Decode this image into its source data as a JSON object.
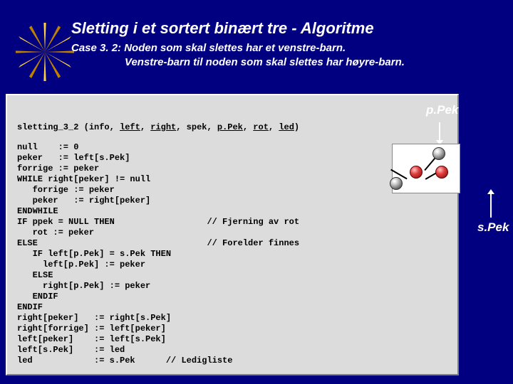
{
  "title": "Sletting i et sortert binært tre   -   Algoritme",
  "subtitle_l1": "Case 3. 2:   Noden som skal slettes har et venstre-barn.",
  "subtitle_l2": "Venstre-barn til noden som skal slettes har høyre-barn.",
  "labels": {
    "ppek": "p.Pek",
    "spek": "s.Pek"
  },
  "sig": {
    "fn": "sletting_3_2",
    "open": " (info, ",
    "a1": "left",
    "c1": ", ",
    "a2": "right",
    "mid": ", spek, ",
    "a3": "p.Pek",
    "c3": ", ",
    "a4": "rot",
    "c4": ", ",
    "a5": "led",
    "close": ")"
  },
  "code": "null    := 0\npeker   := left[s.Pek]\nforrige := peker\nWHILE right[peker] != null\n   forrige := peker\n   peker   := right[peker]\nENDWHILE\nIF ppek = NULL THEN                  // Fjerning av rot\n   rot := peker\nELSE                                 // Forelder finnes\n   IF left[p.Pek] = s.Pek THEN\n     left[p.Pek] := peker\n   ELSE\n     right[p.Pek] := peker\n   ENDIF\nENDIF\nright[peker]   := right[s.Pek]\nright[forrige] := left[peker]\nleft[peker]    := left[s.Pek]\nleft[s.Pek]    := led\nled            := s.Pek      // Ledigliste"
}
